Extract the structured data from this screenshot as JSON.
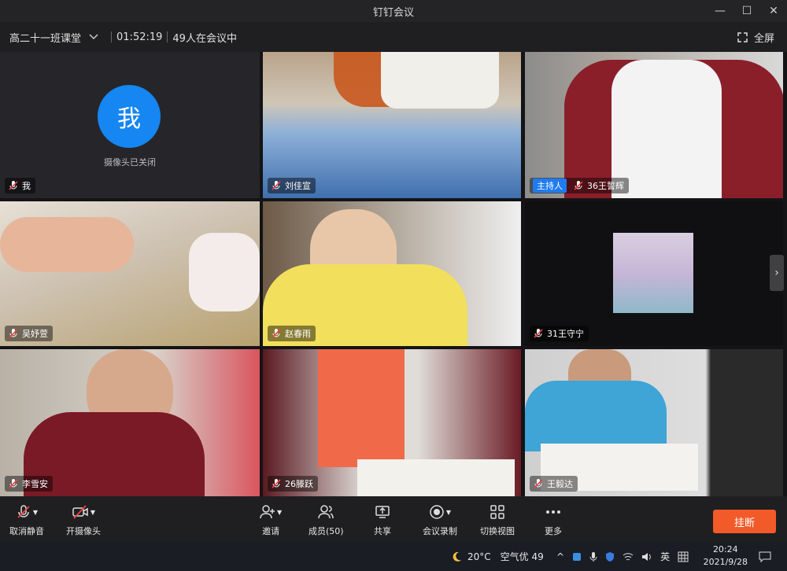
{
  "window": {
    "title": "钉钉会议",
    "minimize": "—",
    "maximize": "☐",
    "close": "✕"
  },
  "meeting": {
    "name": "高二十一班课堂",
    "duration": "01:52:19",
    "participants_text": "49人在会议中",
    "fullscreen_label": "全屏"
  },
  "tiles": [
    {
      "name": "我",
      "camera_off": true,
      "avatar_text": "我",
      "camera_off_text": "摄像头已关闭"
    },
    {
      "name": "刘佳宣"
    },
    {
      "name": "36王誓辉",
      "host_badge": "主持人"
    },
    {
      "name": "吴妤萱"
    },
    {
      "name": "赵春雨"
    },
    {
      "name": "31王守宁"
    },
    {
      "name": "李雪安"
    },
    {
      "name": "26滕跃"
    },
    {
      "name": "王毅达"
    }
  ],
  "toolbar": {
    "unmute": "取消静音",
    "start_camera": "开摄像头",
    "invite": "邀请",
    "members": "成员(50)",
    "share": "共享",
    "record": "会议录制",
    "switch_view": "切换视图",
    "more": "更多",
    "hangup": "挂断"
  },
  "taskbar": {
    "temperature": "20°C",
    "air_quality": "空气优 49",
    "ime": "英",
    "time": "20:24",
    "date": "2021/9/28"
  },
  "colors": {
    "accent_blue": "#1586f2",
    "hangup_red": "#f25a2a",
    "host_badge": "#1e7bf0"
  }
}
